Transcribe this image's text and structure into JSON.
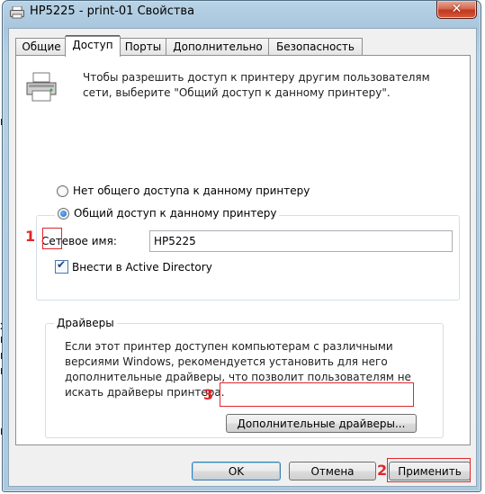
{
  "window": {
    "title": "HP5225 - print-01 Свойства",
    "close_glyph": "✕"
  },
  "tabs": [
    {
      "label": "Общие"
    },
    {
      "label": "Доступ"
    },
    {
      "label": "Порты"
    },
    {
      "label": "Дополнительно"
    },
    {
      "label": "Безопасность"
    }
  ],
  "active_tab": "Доступ",
  "sharing": {
    "intro_text": "Чтобы разрешить доступ к принтеру другим пользователям сети, выберите \"Общий доступ к данному принтеру\".",
    "radio_no_share": "Нет общего доступа к данному принтеру",
    "radio_share": "Общий доступ к данному принтеру",
    "selected_option": "share",
    "share_name_label": "Сетевое имя:",
    "share_name_value": "HP5225",
    "publish_ad_label": "Внести в Active Directory",
    "publish_ad_checked": true
  },
  "drivers": {
    "group_title": "Драйверы",
    "description": "Если этот принтер доступен компьютерам с различными версиями Windows, рекомендуется установить для него дополнительные драйверы, что позволит пользователям не искать драйверы принтера.",
    "additional_drivers_button": "Дополнительные драйверы..."
  },
  "buttons": {
    "ok": "OK",
    "cancel": "Отмена",
    "apply": "Применить"
  },
  "annotations": {
    "marker_1": "1",
    "marker_2": "2",
    "marker_3": "3",
    "color": "#e0262b"
  },
  "background_fragments": [
    "к",
    "х",
    "к",
    "к",
    "к",
    "к"
  ]
}
